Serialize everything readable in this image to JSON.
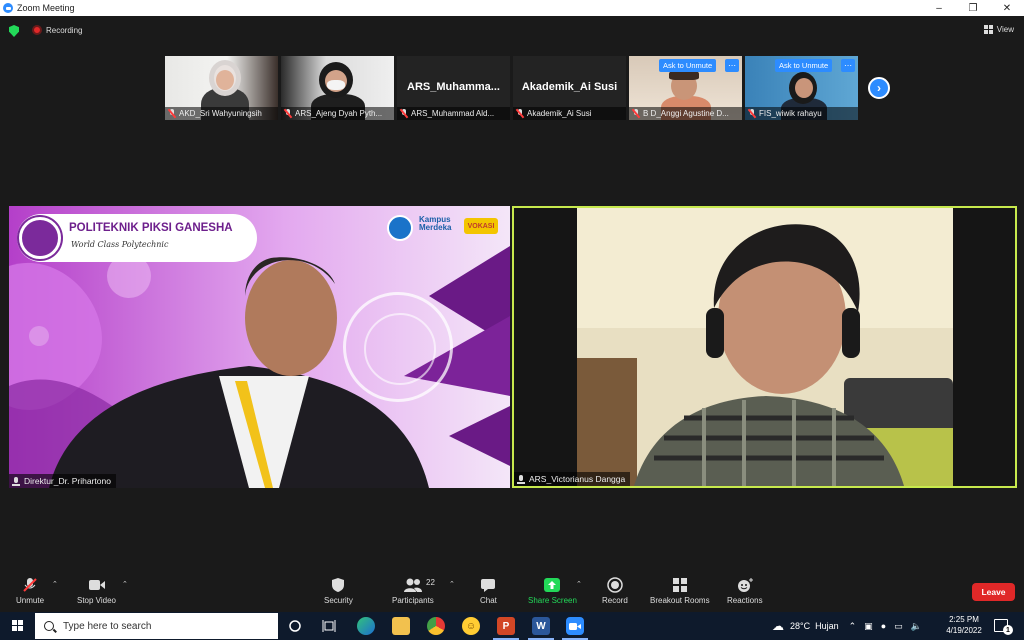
{
  "window": {
    "title": "Zoom Meeting"
  },
  "topbar": {
    "recording_label": "Recording",
    "view_label": "View"
  },
  "thumbnails": [
    {
      "name": "AKD_Sri Wahyuningsih"
    },
    {
      "name": "ARS_Ajeng Dyah Pyth..."
    },
    {
      "name": "ARS_Muhammad Ald...",
      "display_name": "ARS_Muhamma..."
    },
    {
      "name": "Akademik_Ai Susi",
      "display_name": "Akademik_Ai Susi"
    },
    {
      "name": "B D_Anggi Agustine D...",
      "ask_unmute": "Ask to Unmute"
    },
    {
      "name": "FIS_wiwik rahayu",
      "ask_unmute": "Ask to Unmute"
    }
  ],
  "main_tiles": {
    "left": {
      "name": "Direktur_Dr. Prihartono",
      "banner_title": "POLITEKNIK PIKSI GANESHA",
      "banner_sub": "World Class Polytechnic",
      "kampus": "Kampus\nMerdeka",
      "vokasi": "VOKASI"
    },
    "right": {
      "name": "ARS_Victorianus Dangga"
    }
  },
  "toolbar": {
    "unmute": "Unmute",
    "stop_video": "Stop Video",
    "security": "Security",
    "participants": "Participants",
    "participants_count": "22",
    "chat": "Chat",
    "share_screen": "Share Screen",
    "record": "Record",
    "breakout_rooms": "Breakout Rooms",
    "reactions": "Reactions",
    "leave": "Leave"
  },
  "taskbar": {
    "search_placeholder": "Type here to search",
    "weather_temp": "28°C",
    "weather_desc": "Hujan",
    "time": "2:25 PM",
    "date": "4/19/2022",
    "notif_count": "1"
  },
  "colors": {
    "accent": "#2d8cff",
    "active_speaker": "#c7e94d",
    "leave": "#e02828",
    "share": "#23d959"
  }
}
